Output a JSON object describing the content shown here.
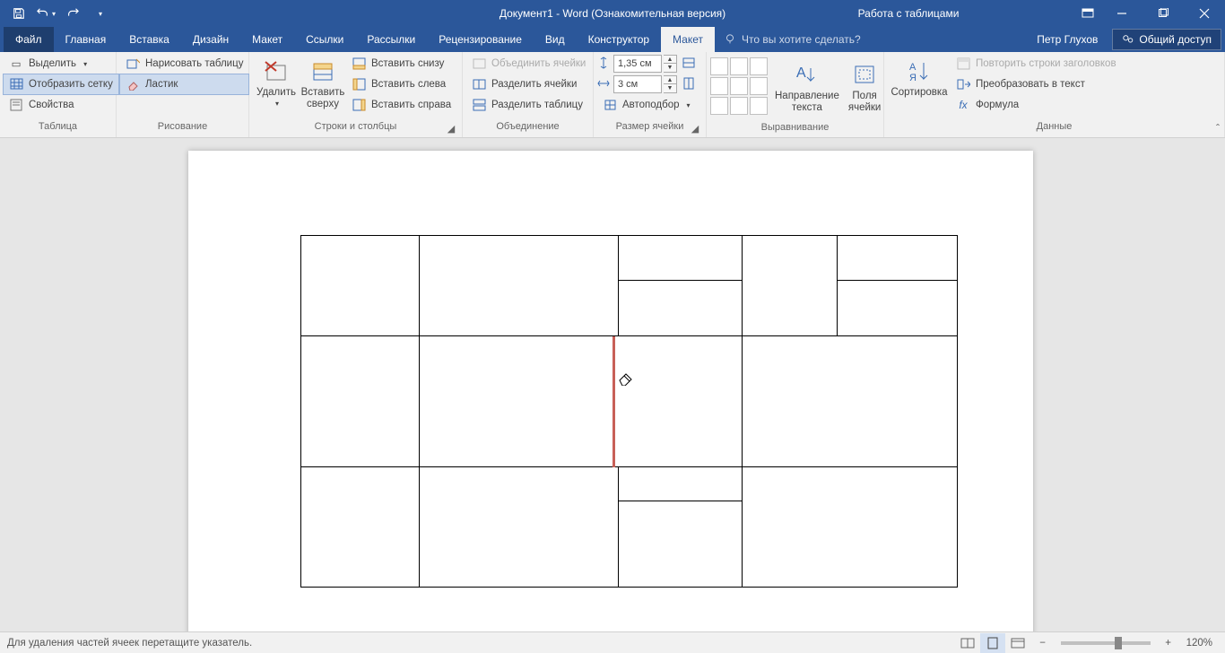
{
  "title": "Документ1 - Word (Ознакомительная версия)",
  "context_title": "Работа с таблицами",
  "tabs": {
    "file": "Файл",
    "home": "Главная",
    "insert": "Вставка",
    "design": "Дизайн",
    "layout": "Макет",
    "references": "Ссылки",
    "mailings": "Рассылки",
    "review": "Рецензирование",
    "view": "Вид",
    "constructor": "Конструктор",
    "table_layout": "Макет"
  },
  "tellme": "Что вы хотите сделать?",
  "user": "Петр Глухов",
  "share": "Общий доступ",
  "ribbon": {
    "table_group": {
      "label": "Таблица",
      "select": "Выделить",
      "gridlines": "Отобразить сетку",
      "properties": "Свойства"
    },
    "draw_group": {
      "label": "Рисование",
      "draw": "Нарисовать таблицу",
      "eraser": "Ластик"
    },
    "rowscols_group": {
      "label": "Строки и столбцы",
      "delete": "Удалить",
      "insert_above": "Вставить сверху",
      "insert_below": "Вставить снизу",
      "insert_left": "Вставить слева",
      "insert_right": "Вставить справа"
    },
    "merge_group": {
      "label": "Объединение",
      "merge": "Объединить ячейки",
      "split": "Разделить ячейки",
      "split_table": "Разделить таблицу"
    },
    "size_group": {
      "label": "Размер ячейки",
      "height": "1,35 см",
      "width": "3 см",
      "autofit": "Автоподбор"
    },
    "align_group": {
      "label": "Выравнивание",
      "direction": "Направление текста",
      "margins": "Поля ячейки"
    },
    "data_group": {
      "label": "Данные",
      "sort": "Сортировка",
      "repeat": "Повторить строки заголовков",
      "convert": "Преобразовать в текст",
      "formula": "Формула"
    }
  },
  "status": {
    "hint": "Для удаления частей ячеек перетащите указатель.",
    "zoom": "120%"
  }
}
